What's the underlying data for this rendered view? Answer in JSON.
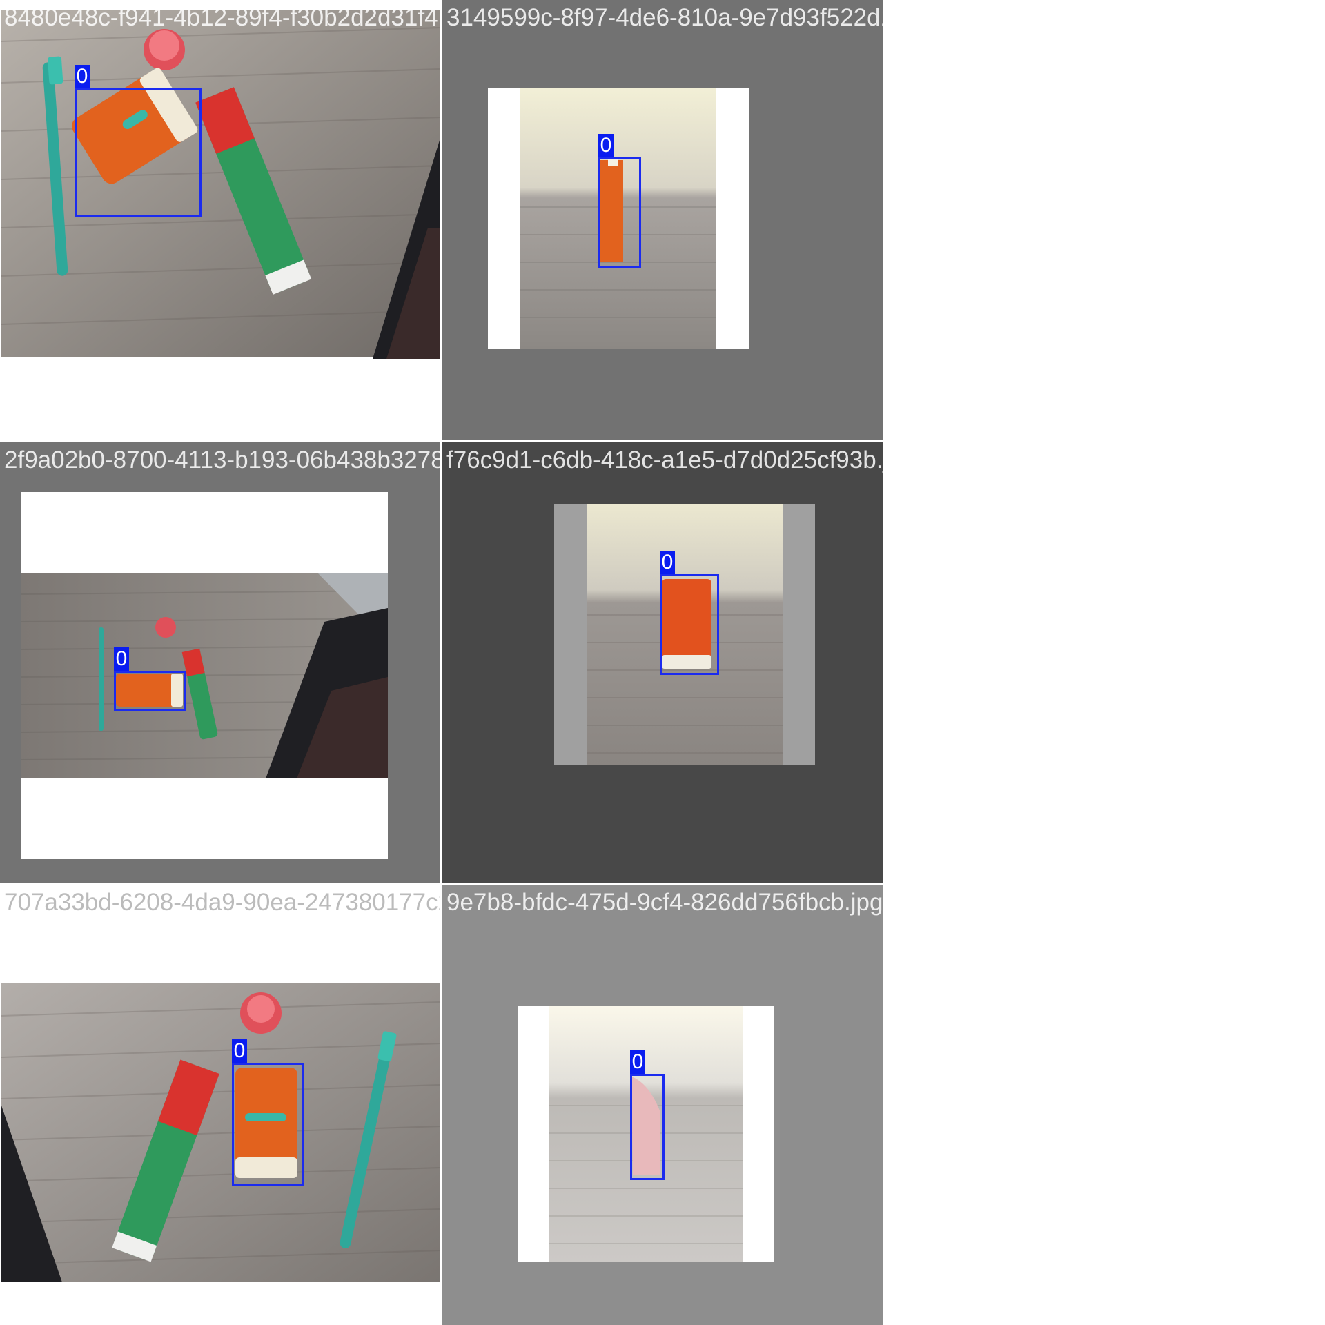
{
  "mosaic": {
    "tiles": [
      {
        "filename": "8480e48c-f941-4b12-89f4-f30b2d2d31f4.jpg",
        "class_label": "0"
      },
      {
        "filename": "3149599c-8f97-4de6-810a-9e7d93f522d1.jpg",
        "class_label": "0"
      },
      {
        "filename": "2f9a02b0-8700-4113-b193-06b438b32786.jpg",
        "class_label": "0"
      },
      {
        "filename": "f76c9d1-c6db-418c-a1e5-d7d0d25cf93b.jpg",
        "class_label": "0"
      },
      {
        "filename": "707a33bd-6208-4da9-90ea-247380177c28.jpg",
        "class_label": "0"
      },
      {
        "filename": "9e7b8-bfdc-475d-9cf4-826dd756fbcb.jpg",
        "class_label": "0"
      }
    ]
  },
  "colors": {
    "box": "#1b2bef",
    "label_bg": "#0a1df0",
    "toothpaste_red": "#d9332e",
    "toothpaste_green": "#2f9a5c",
    "sunscreen_orange": "#e2621e",
    "toothbrush_teal": "#2fa89a",
    "desk": "#8a8480"
  }
}
